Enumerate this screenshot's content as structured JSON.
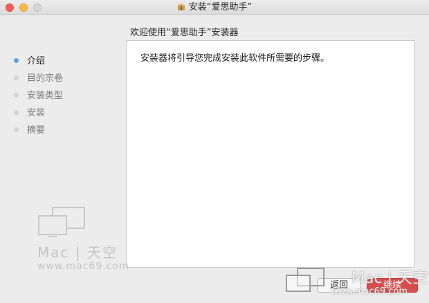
{
  "window": {
    "title": "安装“爱思助手”",
    "title_icon": "package-icon"
  },
  "heading": "欢迎使用“爱思助手”安装器",
  "sidebar": {
    "steps": [
      {
        "label": "介绍",
        "active": true
      },
      {
        "label": "目的宗卷",
        "active": false
      },
      {
        "label": "安装类型",
        "active": false
      },
      {
        "label": "安装",
        "active": false
      },
      {
        "label": "摘要",
        "active": false
      }
    ]
  },
  "content": {
    "text": "安装器将引导您完成安装此软件所需要的步骤。"
  },
  "buttons": {
    "back": "返回",
    "continue": "继续"
  },
  "watermark": {
    "brand": "Mac | 天空",
    "url": "www.mac69.com",
    "logo_icon": "monitors-icon"
  },
  "colors": {
    "active_dot": "#5aa4e4",
    "inactive_dot": "#d3d3d3",
    "continue_button": "#d94c4c",
    "window_bg": "#ececec"
  }
}
